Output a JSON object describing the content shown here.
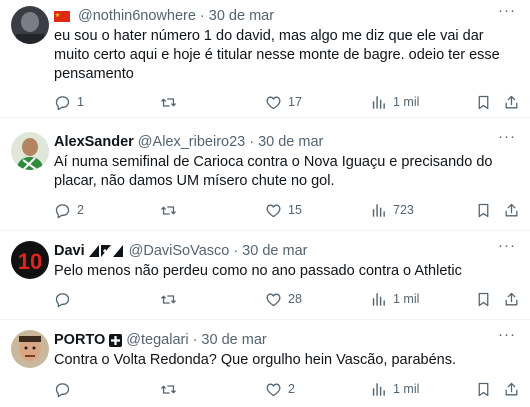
{
  "tweets": [
    {
      "name": "",
      "handle": "@nothin6nowhere",
      "date": "30 de mar",
      "text": "eu sou o hater número 1 do david, mas algo me diz que ele vai dar muito certo aqui e hoje é titular nesse monte de bagre. odeio ter esse pensamento",
      "replies": "1",
      "retweets": "",
      "likes": "17",
      "views": "1 mil"
    },
    {
      "name": "AlexSander",
      "handle": "@Alex_ribeiro23",
      "date": "30 de mar",
      "text": "Aí numa semifinal de Carioca contra o Nova Iguaçu e precisando do placar, não damos UM mísero chute no gol.",
      "replies": "2",
      "retweets": "",
      "likes": "15",
      "views": "723"
    },
    {
      "name": "Davi",
      "handle": "@DaviSoVasco",
      "date": "30 de mar",
      "text": "Pelo menos não perdeu como no ano passado contra o Athletic",
      "replies": "",
      "retweets": "",
      "likes": "28",
      "views": "1 mil"
    },
    {
      "name": "PORTO",
      "handle": "@tegalari",
      "date": "30 de mar",
      "text": "Contra o Volta Redonda? Que orgulho hein Vascão, parabéns.",
      "replies": "",
      "retweets": "",
      "likes": "2",
      "views": "1 mil"
    }
  ],
  "ui": {
    "separator": "·",
    "more": "···"
  },
  "colors": {
    "text": "#0f1419",
    "muted": "#536471",
    "divider": "#eff3f4"
  }
}
